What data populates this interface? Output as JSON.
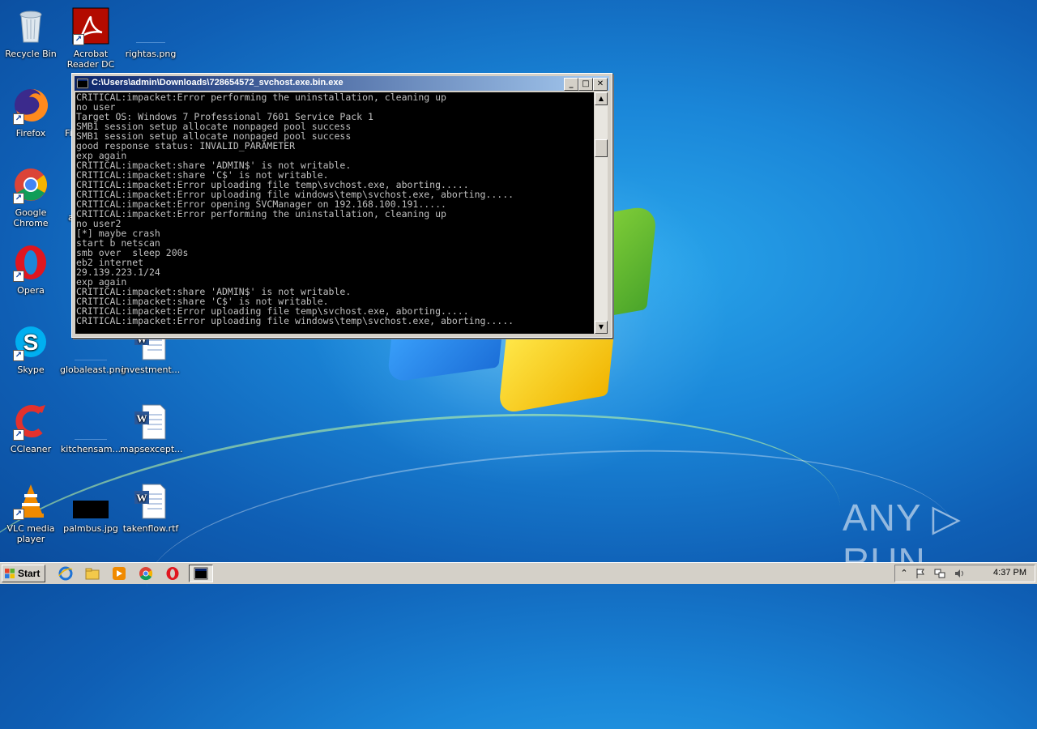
{
  "desktop": {
    "icons": [
      {
        "label": "Recycle Bin"
      },
      {
        "label": "Acrobat Reader DC"
      },
      {
        "label": "rightas.png"
      },
      {
        "label": "Firefox"
      },
      {
        "label": "Fi"
      },
      {
        "label": "Google Chrome"
      },
      {
        "label": "a"
      },
      {
        "label": "Opera"
      },
      {
        "label": "Skype"
      },
      {
        "label": "globaleast.png"
      },
      {
        "label": "investment..."
      },
      {
        "label": "CCleaner"
      },
      {
        "label": "kitchensam..."
      },
      {
        "label": "mapsexcept..."
      },
      {
        "label": "VLC media player"
      },
      {
        "label": "palmbus.jpg"
      },
      {
        "label": "takenflow.rtf"
      }
    ]
  },
  "console_window": {
    "title": "C:\\Users\\admin\\Downloads\\728654572_svchost.exe.bin.exe",
    "lines": [
      "CRITICAL:impacket:Error performing the uninstallation, cleaning up",
      "no user",
      "Target OS: Windows 7 Professional 7601 Service Pack 1",
      "SMB1 session setup allocate nonpaged pool success",
      "SMB1 session setup allocate nonpaged pool success",
      "good response status: INVALID_PARAMETER",
      "exp again",
      "CRITICAL:impacket:share 'ADMIN$' is not writable.",
      "CRITICAL:impacket:share 'C$' is not writable.",
      "CRITICAL:impacket:Error uploading file temp\\svchost.exe, aborting.....",
      "CRITICAL:impacket:Error uploading file windows\\temp\\svchost.exe, aborting.....",
      "CRITICAL:impacket:Error opening SVCManager on 192.168.100.191.....",
      "CRITICAL:impacket:Error performing the uninstallation, cleaning up",
      "no user2",
      "[*] maybe crash",
      "start b netscan",
      "smb over  sleep 200s",
      "eb2 internet",
      "29.139.223.1/24",
      "exp again",
      "CRITICAL:impacket:share 'ADMIN$' is not writable.",
      "CRITICAL:impacket:share 'C$' is not writable.",
      "CRITICAL:impacket:Error uploading file temp\\svchost.exe, aborting.....",
      "CRITICAL:impacket:Error uploading file windows\\temp\\svchost.exe, aborting....."
    ],
    "buttons": {
      "minimize": "_",
      "maximize": "□",
      "close": "✕"
    },
    "scroll_up": "▲",
    "scroll_down": "▼"
  },
  "watermark": "ANY ▷ RUN",
  "taskbar": {
    "start_label": "Start",
    "clock": "4:37 PM",
    "tray_expand": "⌃"
  },
  "colors": {
    "console_text": "#c0c0c0",
    "titlebar_start": "#0a246a",
    "titlebar_end": "#a6caf0"
  }
}
